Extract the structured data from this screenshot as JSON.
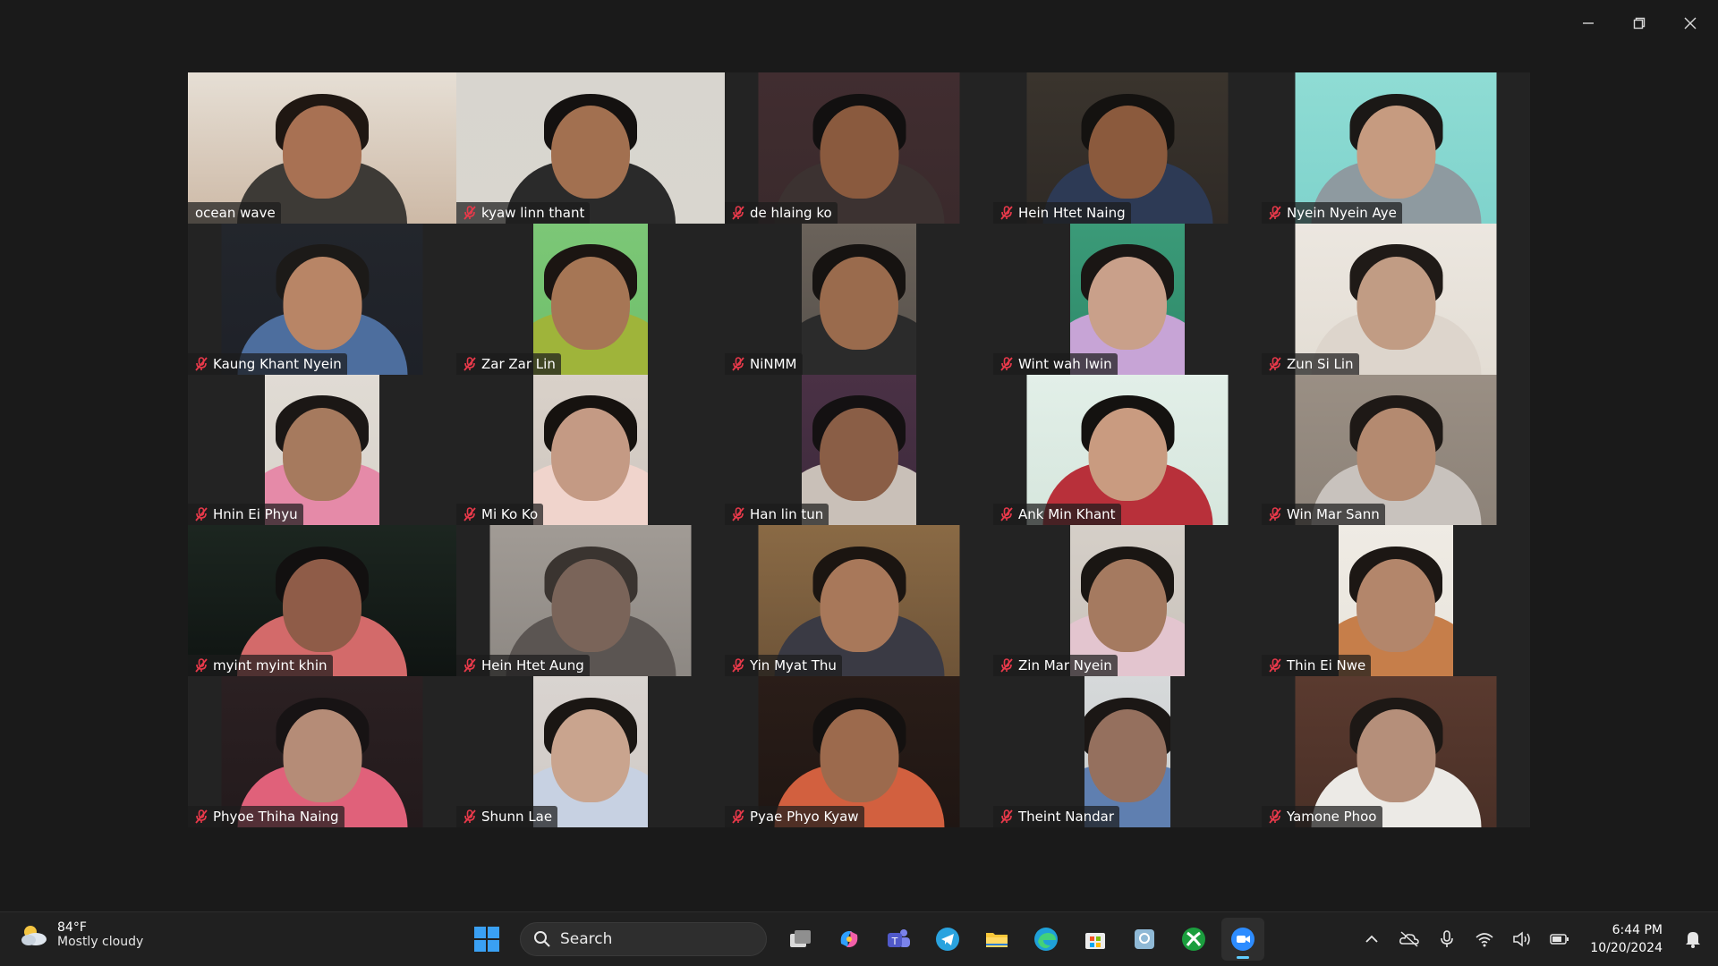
{
  "participants": [
    {
      "name": "ocean wave",
      "muted": false,
      "active": true,
      "aspect": "full",
      "bg": "#cdb9a6",
      "wall": "#e6dfd5",
      "skin": "#a87153",
      "hair": "#1f1712",
      "shirt": "#3d3a36"
    },
    {
      "name": "kyaw linn thant",
      "muted": true,
      "aspect": "full",
      "bg": "#d9d6cf",
      "wall": "#d8d5cf",
      "skin": "#a27050",
      "hair": "#141110",
      "shirt": "#2a2a2a"
    },
    {
      "name": "de hlaing ko",
      "muted": true,
      "aspect": "wide",
      "bg": "#3a2a2c",
      "wall": "#412d30",
      "skin": "#8a5a3e",
      "hair": "#121010",
      "shirt": "#3c3231"
    },
    {
      "name": "Hein Htet Naing",
      "muted": true,
      "aspect": "wide",
      "bg": "#2f2a26",
      "wall": "#3a342d",
      "skin": "#8b5a3d",
      "hair": "#141210",
      "shirt": "#2d3a55"
    },
    {
      "name": "Nyein Nyein Aye",
      "muted": true,
      "aspect": "wide",
      "bg": "#7fd3cc",
      "wall": "#8fdcd4",
      "skin": "#c69b80",
      "hair": "#1b1816",
      "shirt": "#8e9aa0"
    },
    {
      "name": "Kaung Khant Nyein",
      "muted": true,
      "aspect": "wide",
      "bg": "#1e2128",
      "wall": "#23262c",
      "skin": "#b88566",
      "hair": "#1c1a18",
      "shirt": "#4d6e9e"
    },
    {
      "name": "Zar Zar Lin",
      "muted": true,
      "aspect": "narrow",
      "bg": "#6fbf6a",
      "wall": "#7cc777",
      "skin": "#a67655",
      "hair": "#1b1512",
      "shirt": "#9fb43a"
    },
    {
      "name": "NiNMM",
      "muted": true,
      "aspect": "narrow",
      "bg": "#57514b",
      "wall": "#6a625a",
      "skin": "#9a6b4d",
      "hair": "#161311",
      "shirt": "#2b2b2b"
    },
    {
      "name": "Wint wah lwin",
      "muted": true,
      "aspect": "narrow",
      "bg": "#2e8a6a",
      "wall": "#3b9a78",
      "skin": "#c9a08a",
      "hair": "#1a1614",
      "shirt": "#c7a4d6"
    },
    {
      "name": "Zun Si Lin",
      "muted": true,
      "aspect": "wide",
      "bg": "#e3ddd4",
      "wall": "#ece7e0",
      "skin": "#c19c84",
      "hair": "#1f1a17",
      "shirt": "#ddd5cc"
    },
    {
      "name": "Hnin Ei Phyu",
      "muted": true,
      "aspect": "narrow",
      "bg": "#d8d2cb",
      "wall": "#e0dbd4",
      "skin": "#a67a5e",
      "hair": "#1b1715",
      "shirt": "#e58aa8"
    },
    {
      "name": "Mi Ko Ko",
      "muted": true,
      "aspect": "narrow",
      "bg": "#cfc7c0",
      "wall": "#d9d1c9",
      "skin": "#c49a84",
      "hair": "#16120f",
      "shirt": "#f0d4cc"
    },
    {
      "name": "Han lin tun",
      "muted": true,
      "aspect": "narrow",
      "bg": "#3d2a3c",
      "wall": "#4a3145",
      "skin": "#8a5e46",
      "hair": "#141112",
      "shirt": "#c9c0b8"
    },
    {
      "name": "Ank Min Khant",
      "muted": true,
      "aspect": "wide",
      "bg": "#d6e6dd",
      "wall": "#e2efe8",
      "skin": "#c99b80",
      "hair": "#141210",
      "shirt": "#b8303a"
    },
    {
      "name": "Win Mar Sann",
      "muted": true,
      "aspect": "wide",
      "bg": "#8c8278",
      "wall": "#9a8f84",
      "skin": "#b48a70",
      "hair": "#1e1916",
      "shirt": "#c8c2bd"
    },
    {
      "name": "myint myint khin",
      "muted": true,
      "aspect": "full",
      "bg": "#0f1412",
      "wall": "#1c2620",
      "skin": "#8f5c48",
      "hair": "#121010",
      "shirt": "#d36a6a"
    },
    {
      "name": "Hein Htet Aung",
      "muted": true,
      "aspect": "wide",
      "bg": "#8d8883",
      "wall": "#a19b95",
      "skin": "#7a6459",
      "hair": "#3a3430",
      "shirt": "#5b5552"
    },
    {
      "name": "Yin Myat Thu",
      "muted": true,
      "aspect": "wide",
      "bg": "#6e5438",
      "wall": "#8a6a45",
      "skin": "#a8785a",
      "hair": "#1b1511",
      "shirt": "#3a3a44"
    },
    {
      "name": "Zin Mar Nyein",
      "muted": true,
      "aspect": "narrow",
      "bg": "#c9c2bb",
      "wall": "#d5cfc8",
      "skin": "#a57a60",
      "hair": "#1a1613",
      "shirt": "#e3c5cf"
    },
    {
      "name": "Thin Ei Nwe",
      "muted": true,
      "aspect": "narrow",
      "bg": "#e8e4dc",
      "wall": "#efebe4",
      "skin": "#b3866b",
      "hair": "#1c1714",
      "shirt": "#c67e4a"
    },
    {
      "name": "Phyoe Thiha Naing",
      "muted": true,
      "aspect": "wide",
      "bg": "#231a1c",
      "wall": "#2b2022",
      "skin": "#b58c77",
      "hair": "#171314",
      "shirt": "#e0617a"
    },
    {
      "name": "Shunn Lae",
      "muted": true,
      "aspect": "narrow",
      "bg": "#cfc9c5",
      "wall": "#d9d4d0",
      "skin": "#c9a48e",
      "hair": "#1a1613",
      "shirt": "#c7d1e2"
    },
    {
      "name": "Pyae Phyo Kyaw",
      "muted": true,
      "aspect": "wide",
      "bg": "#1f1613",
      "wall": "#2a1d18",
      "skin": "#9c6a4d",
      "hair": "#141110",
      "shirt": "#d2603f"
    },
    {
      "name": "Theint Nandar",
      "muted": true,
      "aspect": "xnarrow",
      "bg": "#c9cccd",
      "wall": "#d6d9da",
      "skin": "#95705e",
      "hair": "#1b1715",
      "shirt": "#5f7fb0"
    },
    {
      "name": "Yamone Phoo",
      "muted": true,
      "aspect": "wide",
      "bg": "#4a3027",
      "wall": "#5a3a2f",
      "skin": "#b58f7a",
      "hair": "#1d1815",
      "shirt": "#eceae6"
    }
  ],
  "weather": {
    "temp": "84°F",
    "desc": "Mostly cloudy"
  },
  "search": {
    "label": "Search"
  },
  "clock": {
    "time": "6:44 PM",
    "date": "10/20/2024"
  },
  "taskbar_apps": [
    "task-view",
    "copilot",
    "teams",
    "telegram",
    "file-explorer",
    "edge",
    "microsoft-store",
    "photos",
    "xbox",
    "zoom"
  ],
  "colors": {
    "active_speaker": "#2fd46a",
    "mute": "#e8394a",
    "taskbar": "#202020",
    "indicator": "#60cdff"
  }
}
